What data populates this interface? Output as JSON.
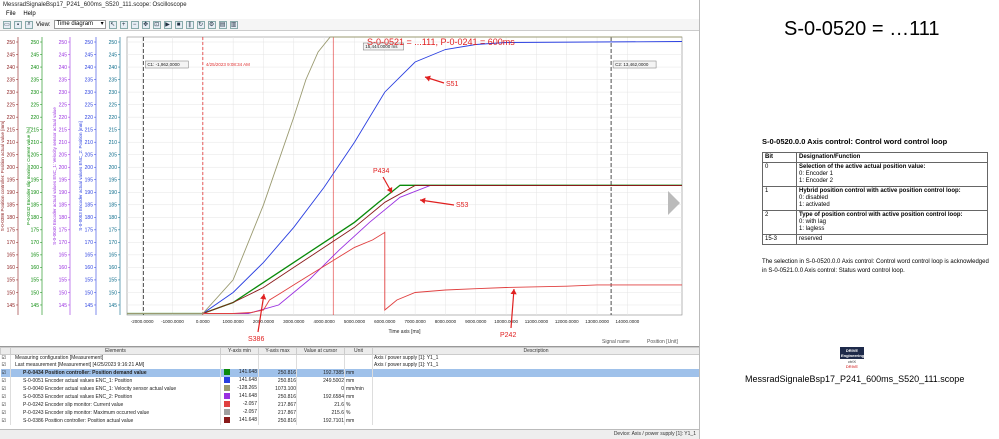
{
  "window": {
    "title": "MessradSignaleBsp17_P241_600ms_S520_111.scope: Oscilloscope"
  },
  "menu": {
    "file": "File",
    "help": "Help"
  },
  "toolbar": {
    "view_label": "View:",
    "view_value": "Time diagram"
  },
  "chart": {
    "annotation_top": "S-0-0521 = ...111,  P-0-0241 = 600ms",
    "cursor1_label": "C1: -1,962,0000",
    "cursor2_label": "C2: 13,462,0000",
    "timestamp_label": "4/25/2023 9:08:34 AM",
    "cursor_readout": "15,444.0000 ms",
    "x_axis_label": "Time axis [ms]",
    "signal_name_label": "Signal name",
    "position_unit_label": "Position  [Unit]",
    "labels": {
      "s51": "S51",
      "p434": "P434",
      "s53": "S53",
      "s386": "S386",
      "p242": "P242"
    },
    "axis_titles": [
      "S-0-0386 Position controller: Position actual value  [mm]",
      "P-0-0242 Encoder slip monitor: Current value [%]",
      "S-0-0040 Encoder actual values ENC_1: Velocity sensor actual value",
      "S-0-0053 Encoder actual values ENC_2: Position [mm]"
    ],
    "colors": {
      "s386": "#8a1a1a",
      "p242": "#e04040",
      "s51": "#2a3fe0",
      "p434": "#0a8a0a",
      "s53": "#9a30e0",
      "tan": "#9a9a70"
    }
  },
  "chart_data": {
    "type": "line",
    "title": "",
    "xlabel": "Time axis [ms]",
    "ylabel": "",
    "xlim": [
      -2500,
      15800
    ],
    "ylim": [
      141,
      252
    ],
    "x_ticks": [
      "-2000.0000",
      "-1000.0000",
      "0.0000",
      "1000.0000",
      "2000.0000",
      "3000.0000",
      "4000.0000",
      "5000.0000",
      "6000.0000",
      "7000.0000",
      "8000.0000",
      "9000.0000",
      "10000.0000",
      "11000.0000",
      "12000.0000",
      "13000.0000",
      "14000.0000"
    ],
    "y_ticks": [
      "145",
      "150",
      "155",
      "160",
      "165",
      "170",
      "175",
      "180",
      "185",
      "190",
      "195",
      "200",
      "205",
      "210",
      "215",
      "220",
      "225",
      "230",
      "235",
      "240",
      "245",
      "250"
    ],
    "series": [
      {
        "name": "P-0-0434",
        "color": "#0a8a0a",
        "x": [
          -2500,
          0,
          1000,
          2000,
          3000,
          4000,
          5000,
          5800,
          6500,
          15800
        ],
        "y": [
          141.6,
          141.6,
          146,
          154,
          162,
          170,
          178,
          186,
          192.8,
          192.8
        ]
      },
      {
        "name": "S-0-0051",
        "color": "#2a3fe0",
        "x": [
          -2500,
          0,
          1000,
          2000,
          3000,
          4000,
          5000,
          6000,
          7000,
          8000,
          9000,
          10000,
          15800
        ],
        "y": [
          141.6,
          141.6,
          150,
          162,
          176,
          192,
          210,
          230,
          242,
          247,
          249,
          249.8,
          250.2
        ]
      },
      {
        "name": "S-0-0053",
        "color": "#9a30e0",
        "x": [
          -2500,
          1500,
          2500,
          3500,
          4500,
          5500,
          6500,
          7500,
          15800
        ],
        "y": [
          141.6,
          141.6,
          145,
          155,
          167,
          178,
          188,
          192.7,
          192.7
        ]
      },
      {
        "name": "S-0-0386",
        "color": "#8a1a1a",
        "x": [
          -2500,
          0,
          1000,
          2000,
          3000,
          4000,
          5000,
          6000,
          7000,
          15800
        ],
        "y": [
          141.6,
          141.6,
          146,
          152,
          160,
          168,
          176,
          186,
          192.7,
          192.7
        ]
      },
      {
        "name": "P-0-0242",
        "color": "#e04040",
        "x": [
          -2500,
          1000,
          1600,
          2000,
          2200,
          2600,
          3000,
          3400,
          3800,
          4200,
          4600,
          5000,
          5600,
          6000,
          6000,
          6400,
          7000,
          8000,
          9000,
          10000,
          12000,
          13000,
          15800
        ],
        "y": [
          141.6,
          141.6,
          142,
          143,
          147,
          150,
          153,
          156,
          159,
          162,
          165,
          168,
          171,
          174,
          143,
          147,
          150,
          151,
          151.5,
          152,
          152.5,
          153,
          153
        ]
      },
      {
        "name": "S-0-0040",
        "color": "#9a9a70",
        "x": [
          -2500,
          0,
          1000,
          2000,
          3000,
          3400,
          3800,
          4200,
          4300,
          15800
        ],
        "y": [
          141.6,
          141.6,
          155,
          185,
          220,
          235,
          246,
          252,
          252,
          252
        ]
      }
    ]
  },
  "legend": {
    "headers": [
      "",
      "Elements",
      "Y-axis min",
      "Y-axis max",
      "Value at cursor",
      "Unit",
      "Description"
    ],
    "rows": [
      {
        "element": "Measuring configuration [Measurement]",
        "ymin": "",
        "ymax": "",
        "value": "",
        "unit": "",
        "desc": "Axis / power supply [1]: Y1_1",
        "color": ""
      },
      {
        "element": "Last measurement [Measurement] [4/25/2023 9:16:21 AM]",
        "ymin": "",
        "ymax": "",
        "value": "",
        "unit": "",
        "desc": "Axis / power supply [1]: Y1_1",
        "color": ""
      },
      {
        "element": "P-0-0434 Position controller: Position demand value",
        "ymin": "141.648",
        "ymax": "250.816",
        "value": "192.7385",
        "unit": "mm",
        "desc": "",
        "color": "#0a8a0a",
        "selected": true
      },
      {
        "element": "S-0-0051 Encoder actual values ENC_1: Position",
        "ymin": "141.648",
        "ymax": "250.816",
        "value": "249.5002",
        "unit": "mm",
        "desc": "",
        "color": "#2a3fe0"
      },
      {
        "element": "S-0-0040 Encoder actual values ENC_1: Velocity sensor actual value",
        "ymin": "-128.265",
        "ymax": "1073.100",
        "value": "0",
        "unit": "mm/min",
        "desc": "",
        "color": "#9a9a70"
      },
      {
        "element": "S-0-0053 Encoder actual values ENC_2: Position",
        "ymin": "141.648",
        "ymax": "250.816",
        "value": "192.6584",
        "unit": "mm",
        "desc": "",
        "color": "#9a30e0"
      },
      {
        "element": "P-0-0242 Encoder slip monitor: Current value",
        "ymin": "-2.057",
        "ymax": "217.867",
        "value": "21.6",
        "unit": "%",
        "desc": "",
        "color": "#e04040"
      },
      {
        "element": "P-0-0243 Encoder slip monitor: Maximum occurred value",
        "ymin": "-2.057",
        "ymax": "217.867",
        "value": "215.6",
        "unit": "%",
        "desc": "",
        "color": "#a0a0a0"
      },
      {
        "element": "S-0-0386 Position controller: Position actual value",
        "ymin": "141.648",
        "ymax": "250.816",
        "value": "192.7101",
        "unit": "mm",
        "desc": "",
        "color": "#8a1a1a"
      }
    ]
  },
  "status": {
    "device": "Device: Axis / power supply [1]: Y1_1"
  },
  "doc": {
    "big_title": "S-0-0520 = …111",
    "title": "S-0-0520.0.0  Axis control: Control word control loop",
    "col_bit": "Bit",
    "col_desc": "Designation/Function",
    "rows": [
      {
        "bit": "0",
        "head": "Selection of the active actual position value:",
        "opts": [
          "0: Encoder 1",
          "1: Encoder 2"
        ]
      },
      {
        "bit": "1",
        "head": "Hybrid position control with active position control loop:",
        "opts": [
          "0: disabled",
          "1: activated"
        ]
      },
      {
        "bit": "2",
        "head": "Type of position control with active position control loop:",
        "opts": [
          "0: with lag",
          "1: lagless"
        ]
      },
      {
        "bit": "15-3",
        "head": "reserved",
        "opts": []
      }
    ],
    "note": "The selection in S-0-0520.0.0  Axis control: Control word control loop  is acknowledged in S-0-0521.0.0 Axis control: Status word control loop.",
    "logo_top": "DRIVE Engineering",
    "logo_sub": "ctrlX",
    "logo_sub2": "DRIVE",
    "caption": "MessradSignaleBsp17_P241_600ms_S520_111.scope"
  }
}
